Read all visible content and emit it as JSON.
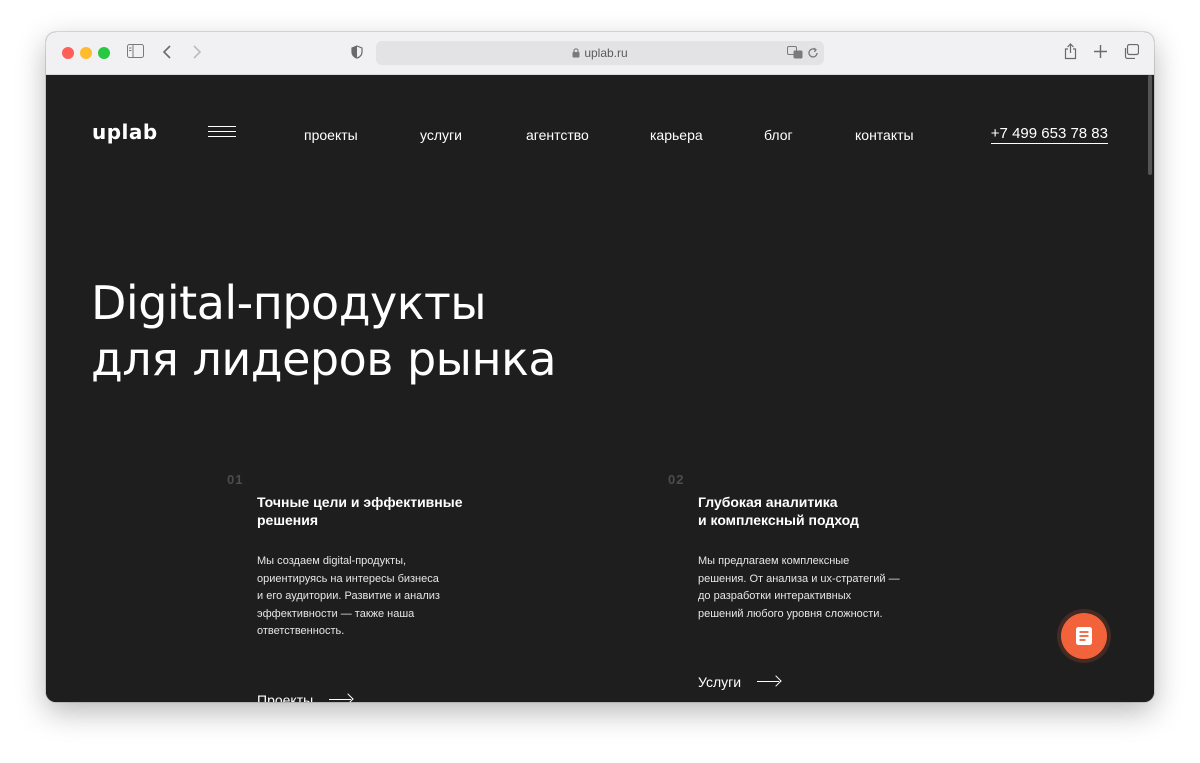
{
  "browser": {
    "url": "uplab.ru",
    "colors": {
      "close": "#ff5f57",
      "minimize": "#febc2e",
      "maximize": "#28c840"
    }
  },
  "site": {
    "logo": "uplab",
    "nav": [
      "проекты",
      "услуги",
      "агентство",
      "карьера",
      "блог",
      "контакты"
    ],
    "phone": "+7 499 653 78 83",
    "hero": {
      "line1": "Digital-продукты",
      "line2": "для лидеров рынка"
    },
    "features": [
      {
        "num": "01",
        "title_lines": [
          "Точные цели и эффективные",
          "решения"
        ],
        "desc_lines": [
          "Мы создаем digital-продукты,",
          "ориентируясь на интересы бизнеса",
          "и его аудитории. Развитие и анализ",
          "эффективности — также наша",
          "ответственность."
        ],
        "link": "Проекты"
      },
      {
        "num": "02",
        "title_lines": [
          "Глубокая аналитика",
          "и комплексный подход"
        ],
        "desc_lines": [
          "Мы предлагаем комплексные",
          "решения. От анализа и ux-стратегий —",
          "до разработки интерактивных",
          "решений любого уровня сложности."
        ],
        "link": "Услуги"
      }
    ],
    "accent": "#f2633b"
  }
}
